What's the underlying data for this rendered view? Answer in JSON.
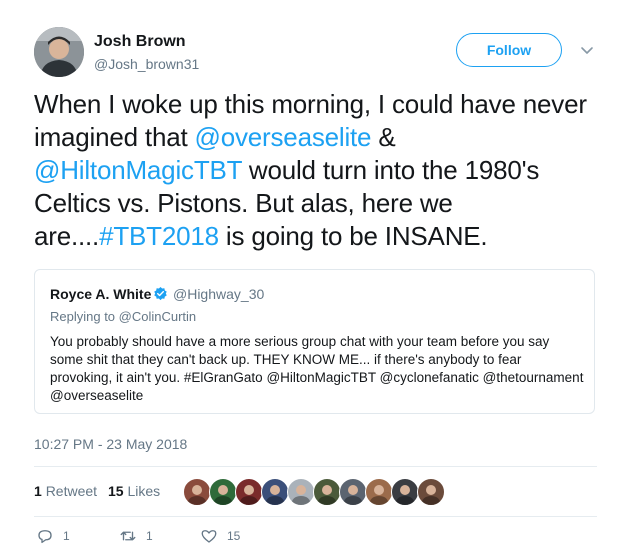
{
  "author": {
    "name": "Josh Brown",
    "handle": "@Josh_brown31"
  },
  "follow": {
    "label": "Follow"
  },
  "tweet": {
    "p1": "When I woke up this morning, I could have never imagined that ",
    "m1": "@overseaselite",
    "p2": " & ",
    "m2": "@HiltonMagicTBT",
    "p3": " would turn into the 1980's Celtics vs. Pistons. But alas, here we are....",
    "h1": "#TBT2018",
    "p4": " is going to be INSANE."
  },
  "quote": {
    "name": "Royce A. White",
    "handle": "@Highway_30",
    "replying_prefix": "Replying to ",
    "replying_to": "@ColinCurtin",
    "body": "You probably should have a more serious group chat with your team before you say some shit that they can't back up. THEY KNOW ME... if there's anybody to fear provoking, it ain't you. #ElGranGato @HiltonMagicTBT @cyclonefanatic @thetournament @overseaselite"
  },
  "timestamp": "10:27 PM - 23 May 2018",
  "stats": {
    "retweets_count": "1",
    "retweets_label": "Retweet",
    "likes_count": "15",
    "likes_label": "Likes"
  },
  "likers": [
    {
      "name": "liker-1",
      "color": "#8a4b3c"
    },
    {
      "name": "liker-2",
      "color": "#2f6b3a"
    },
    {
      "name": "liker-3",
      "color": "#7a2b2b"
    },
    {
      "name": "liker-4",
      "color": "#3b4f7a"
    },
    {
      "name": "liker-5",
      "color": "#aab2ba"
    },
    {
      "name": "liker-6",
      "color": "#4b5a3a"
    },
    {
      "name": "liker-7",
      "color": "#5b6470"
    },
    {
      "name": "liker-8",
      "color": "#9b6b4b"
    },
    {
      "name": "liker-9",
      "color": "#3a3d42"
    },
    {
      "name": "liker-10",
      "color": "#6b4b3b"
    }
  ],
  "actions": {
    "reply_count": "1",
    "retweet_count": "1",
    "like_count": "15"
  },
  "colors": {
    "accent": "#1da1f2",
    "text": "#14171a",
    "muted": "#657786",
    "border": "#e1e8ed"
  },
  "icons": [
    "avatar",
    "chevron-down-icon",
    "verified-badge-icon",
    "reply-icon",
    "retweet-icon",
    "heart-icon"
  ]
}
